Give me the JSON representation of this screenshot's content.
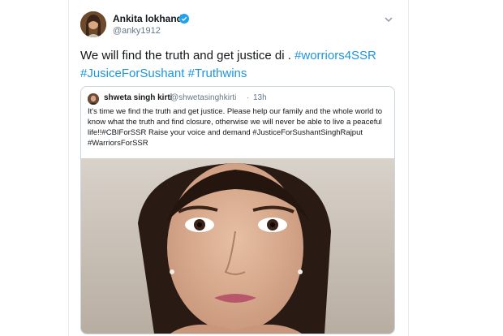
{
  "tweet": {
    "author_name": "Ankita lokhande",
    "author_handle": "@anky1912",
    "text_parts": [
      "We will find the truth and get justice di . ",
      "#worriors4SSR",
      " ",
      "#JusiceForSushant",
      "  ",
      "#Truthwins"
    ]
  },
  "quoted_tweet": {
    "author_name": "shweta singh kirti",
    "author_handle": "@shwetasinghkirti",
    "separator": "·",
    "time": "13h",
    "text": "It's time we find the truth and get justice. Please help our family and the whole world to know what the truth and find closure, otherwise we will never be able to live a peaceful life!!#CBIForSSR Raise your voice and demand #JusticeForSushantSinghRajput #WarriorsForSSR"
  },
  "icons": {
    "verified": "verified-badge-icon",
    "menu": "chevron-down-icon"
  },
  "colors": {
    "hashtag": "#1b95e0",
    "verified": "#1da1f2",
    "text": "#14171a",
    "secondary": "#657786",
    "border": "#ccd6dd"
  }
}
